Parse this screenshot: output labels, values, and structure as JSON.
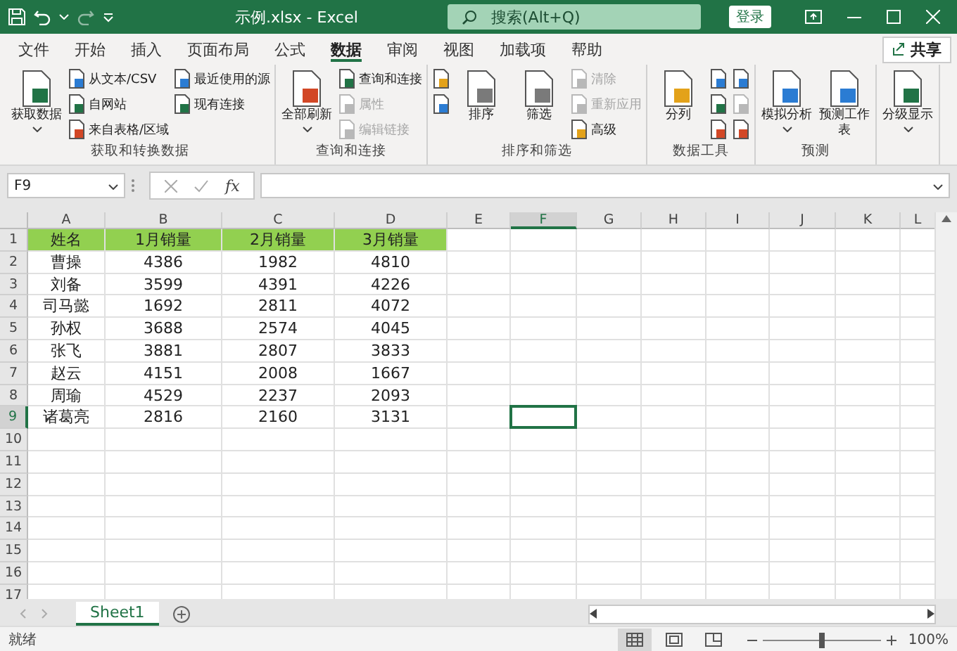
{
  "title_bar": {
    "title": "示例.xlsx  -  Excel",
    "search_placeholder": "搜索(Alt+Q)",
    "sign_in": "登录"
  },
  "menu_tabs": [
    {
      "label": "文件",
      "selected": false
    },
    {
      "label": "开始",
      "selected": false
    },
    {
      "label": "插入",
      "selected": false
    },
    {
      "label": "页面布局",
      "selected": false
    },
    {
      "label": "公式",
      "selected": false
    },
    {
      "label": "数据",
      "selected": true
    },
    {
      "label": "审阅",
      "selected": false
    },
    {
      "label": "视图",
      "selected": false
    },
    {
      "label": "加载项",
      "selected": false
    },
    {
      "label": "帮助",
      "selected": false
    }
  ],
  "share": "共享",
  "ribbon": {
    "groups": [
      {
        "label": "获取和转换数据",
        "columns": [
          [
            {
              "kind": "large",
              "label": "获取数据",
              "dropdown": true,
              "disabled": false
            }
          ],
          [
            {
              "kind": "small",
              "label": "从文本/CSV",
              "disabled": false
            },
            {
              "kind": "small",
              "label": "自网站",
              "disabled": false
            },
            {
              "kind": "small",
              "label": "来自表格/区域",
              "disabled": false
            }
          ],
          [
            {
              "kind": "small",
              "label": "最近使用的源",
              "disabled": false
            },
            {
              "kind": "small",
              "label": "现有连接",
              "disabled": false
            }
          ]
        ]
      },
      {
        "label": "查询和连接",
        "columns": [
          [
            {
              "kind": "large",
              "label": "全部刷新",
              "dropdown": true,
              "disabled": false
            }
          ],
          [
            {
              "kind": "small",
              "label": "查询和连接",
              "disabled": false
            },
            {
              "kind": "small",
              "label": "属性",
              "disabled": true
            },
            {
              "kind": "small",
              "label": "编辑链接",
              "disabled": true
            }
          ]
        ]
      },
      {
        "label": "排序和筛选",
        "columns": [
          [
            {
              "kind": "icon",
              "disabled": false
            },
            {
              "kind": "icon",
              "disabled": false
            }
          ],
          [
            {
              "kind": "large",
              "label": "排序",
              "dropdown": false,
              "disabled": false
            }
          ],
          [
            {
              "kind": "large",
              "label": "筛选",
              "dropdown": false,
              "disabled": false
            }
          ],
          [
            {
              "kind": "small",
              "label": "清除",
              "disabled": true
            },
            {
              "kind": "small",
              "label": "重新应用",
              "disabled": true
            },
            {
              "kind": "small",
              "label": "高级",
              "disabled": false
            }
          ]
        ]
      },
      {
        "label": "数据工具",
        "columns": [
          [
            {
              "kind": "large",
              "label": "分列",
              "dropdown": false,
              "disabled": false
            }
          ],
          [
            {
              "kind": "icon",
              "disabled": false
            },
            {
              "kind": "icon",
              "disabled": false
            },
            {
              "kind": "icon",
              "disabled": false
            }
          ],
          [
            {
              "kind": "icon",
              "disabled": false
            },
            {
              "kind": "icon",
              "disabled": true
            },
            {
              "kind": "icon",
              "disabled": false
            }
          ]
        ]
      },
      {
        "label": "预测",
        "columns": [
          [
            {
              "kind": "large",
              "label": "模拟分析",
              "dropdown": true,
              "disabled": false
            }
          ],
          [
            {
              "kind": "large",
              "label": "预测工作表",
              "dropdown": false,
              "disabled": false
            }
          ]
        ]
      },
      {
        "columns": [
          [
            {
              "kind": "large",
              "label": "分级显示",
              "dropdown": true,
              "disabled": false
            }
          ]
        ]
      }
    ]
  },
  "formula_bar": {
    "name_box": "F9",
    "function_label": "fx"
  },
  "sheet": {
    "columns": [
      {
        "label": "A",
        "selected": false
      },
      {
        "label": "B",
        "selected": false
      },
      {
        "label": "C",
        "selected": false
      },
      {
        "label": "D",
        "selected": false
      },
      {
        "label": "E",
        "selected": false
      },
      {
        "label": "F",
        "selected": true
      },
      {
        "label": "G",
        "selected": false
      },
      {
        "label": "H",
        "selected": false
      },
      {
        "label": "I",
        "selected": false
      },
      {
        "label": "J",
        "selected": false
      },
      {
        "label": "K",
        "selected": false
      },
      {
        "label": "L",
        "selected": false
      }
    ],
    "rows": [
      {
        "number": "1",
        "selected": false,
        "highlighted": true,
        "cells": [
          "姓名",
          "1月销量",
          "2月销量",
          "3月销量"
        ]
      },
      {
        "number": "2",
        "selected": false,
        "highlighted": false,
        "cells": [
          "曹操",
          "4386",
          "1982",
          "4810"
        ]
      },
      {
        "number": "3",
        "selected": false,
        "highlighted": false,
        "cells": [
          "刘备",
          "3599",
          "4391",
          "4226"
        ]
      },
      {
        "number": "4",
        "selected": false,
        "highlighted": false,
        "cells": [
          "司马懿",
          "1692",
          "2811",
          "4072"
        ]
      },
      {
        "number": "5",
        "selected": false,
        "highlighted": false,
        "cells": [
          "孙权",
          "3688",
          "2574",
          "4045"
        ]
      },
      {
        "number": "6",
        "selected": false,
        "highlighted": false,
        "cells": [
          "张飞",
          "3881",
          "2807",
          "3833"
        ]
      },
      {
        "number": "7",
        "selected": false,
        "highlighted": false,
        "cells": [
          "赵云",
          "4151",
          "2008",
          "1667"
        ]
      },
      {
        "number": "8",
        "selected": false,
        "highlighted": false,
        "cells": [
          "周瑜",
          "4529",
          "2237",
          "2093"
        ]
      },
      {
        "number": "9",
        "selected": true,
        "highlighted": false,
        "cells": [
          "诸葛亮",
          "2816",
          "2160",
          "3131"
        ]
      },
      {
        "number": "10",
        "selected": false,
        "highlighted": false,
        "cells": []
      },
      {
        "number": "11",
        "selected": false,
        "highlighted": false,
        "cells": []
      },
      {
        "number": "12",
        "selected": false,
        "highlighted": false,
        "cells": []
      },
      {
        "number": "13",
        "selected": false,
        "highlighted": false,
        "cells": []
      },
      {
        "number": "14",
        "selected": false,
        "highlighted": false,
        "cells": []
      },
      {
        "number": "15",
        "selected": false,
        "highlighted": false,
        "cells": []
      },
      {
        "number": "16",
        "selected": false,
        "highlighted": false,
        "cells": []
      },
      {
        "number": "17",
        "selected": false,
        "highlighted": false,
        "cells": []
      }
    ]
  },
  "sheet_tabs": [
    {
      "label": "Sheet1",
      "selected": true
    }
  ],
  "status_bar": {
    "status": "就绪",
    "views": [
      {
        "selected": true
      },
      {
        "selected": false
      },
      {
        "selected": false
      }
    ],
    "zoom": {
      "level": 0.5,
      "reading": "100%"
    }
  }
}
